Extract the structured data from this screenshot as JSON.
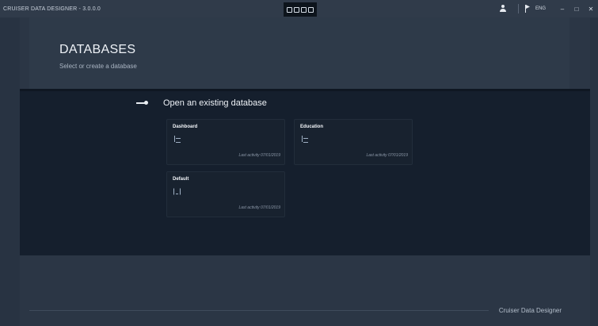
{
  "titlebar": {
    "app_title": "CRUISER DATA DESIGNER - 3.0.0.0",
    "language": "ENG",
    "minimize": "–",
    "maximize": "□",
    "close": "✕"
  },
  "header": {
    "title": "DATABASES",
    "subtitle": "Select or create a database"
  },
  "section": {
    "title": "Open an existing database"
  },
  "databases": [
    {
      "name": "Dashboard",
      "icon": "tree-icon",
      "last_activity": "Last activity  07/01/2019"
    },
    {
      "name": "Education",
      "icon": "tree-icon",
      "last_activity": "Last activity  07/01/2019"
    },
    {
      "name": "Default",
      "icon": "bracket-icon",
      "last_activity": "Last activity  07/01/2019"
    }
  ],
  "footer": {
    "brand": "Cruiser Data Designer"
  },
  "colors": {
    "background": "#2b3645",
    "main_band": "#151f2d",
    "card": "#18222f"
  }
}
